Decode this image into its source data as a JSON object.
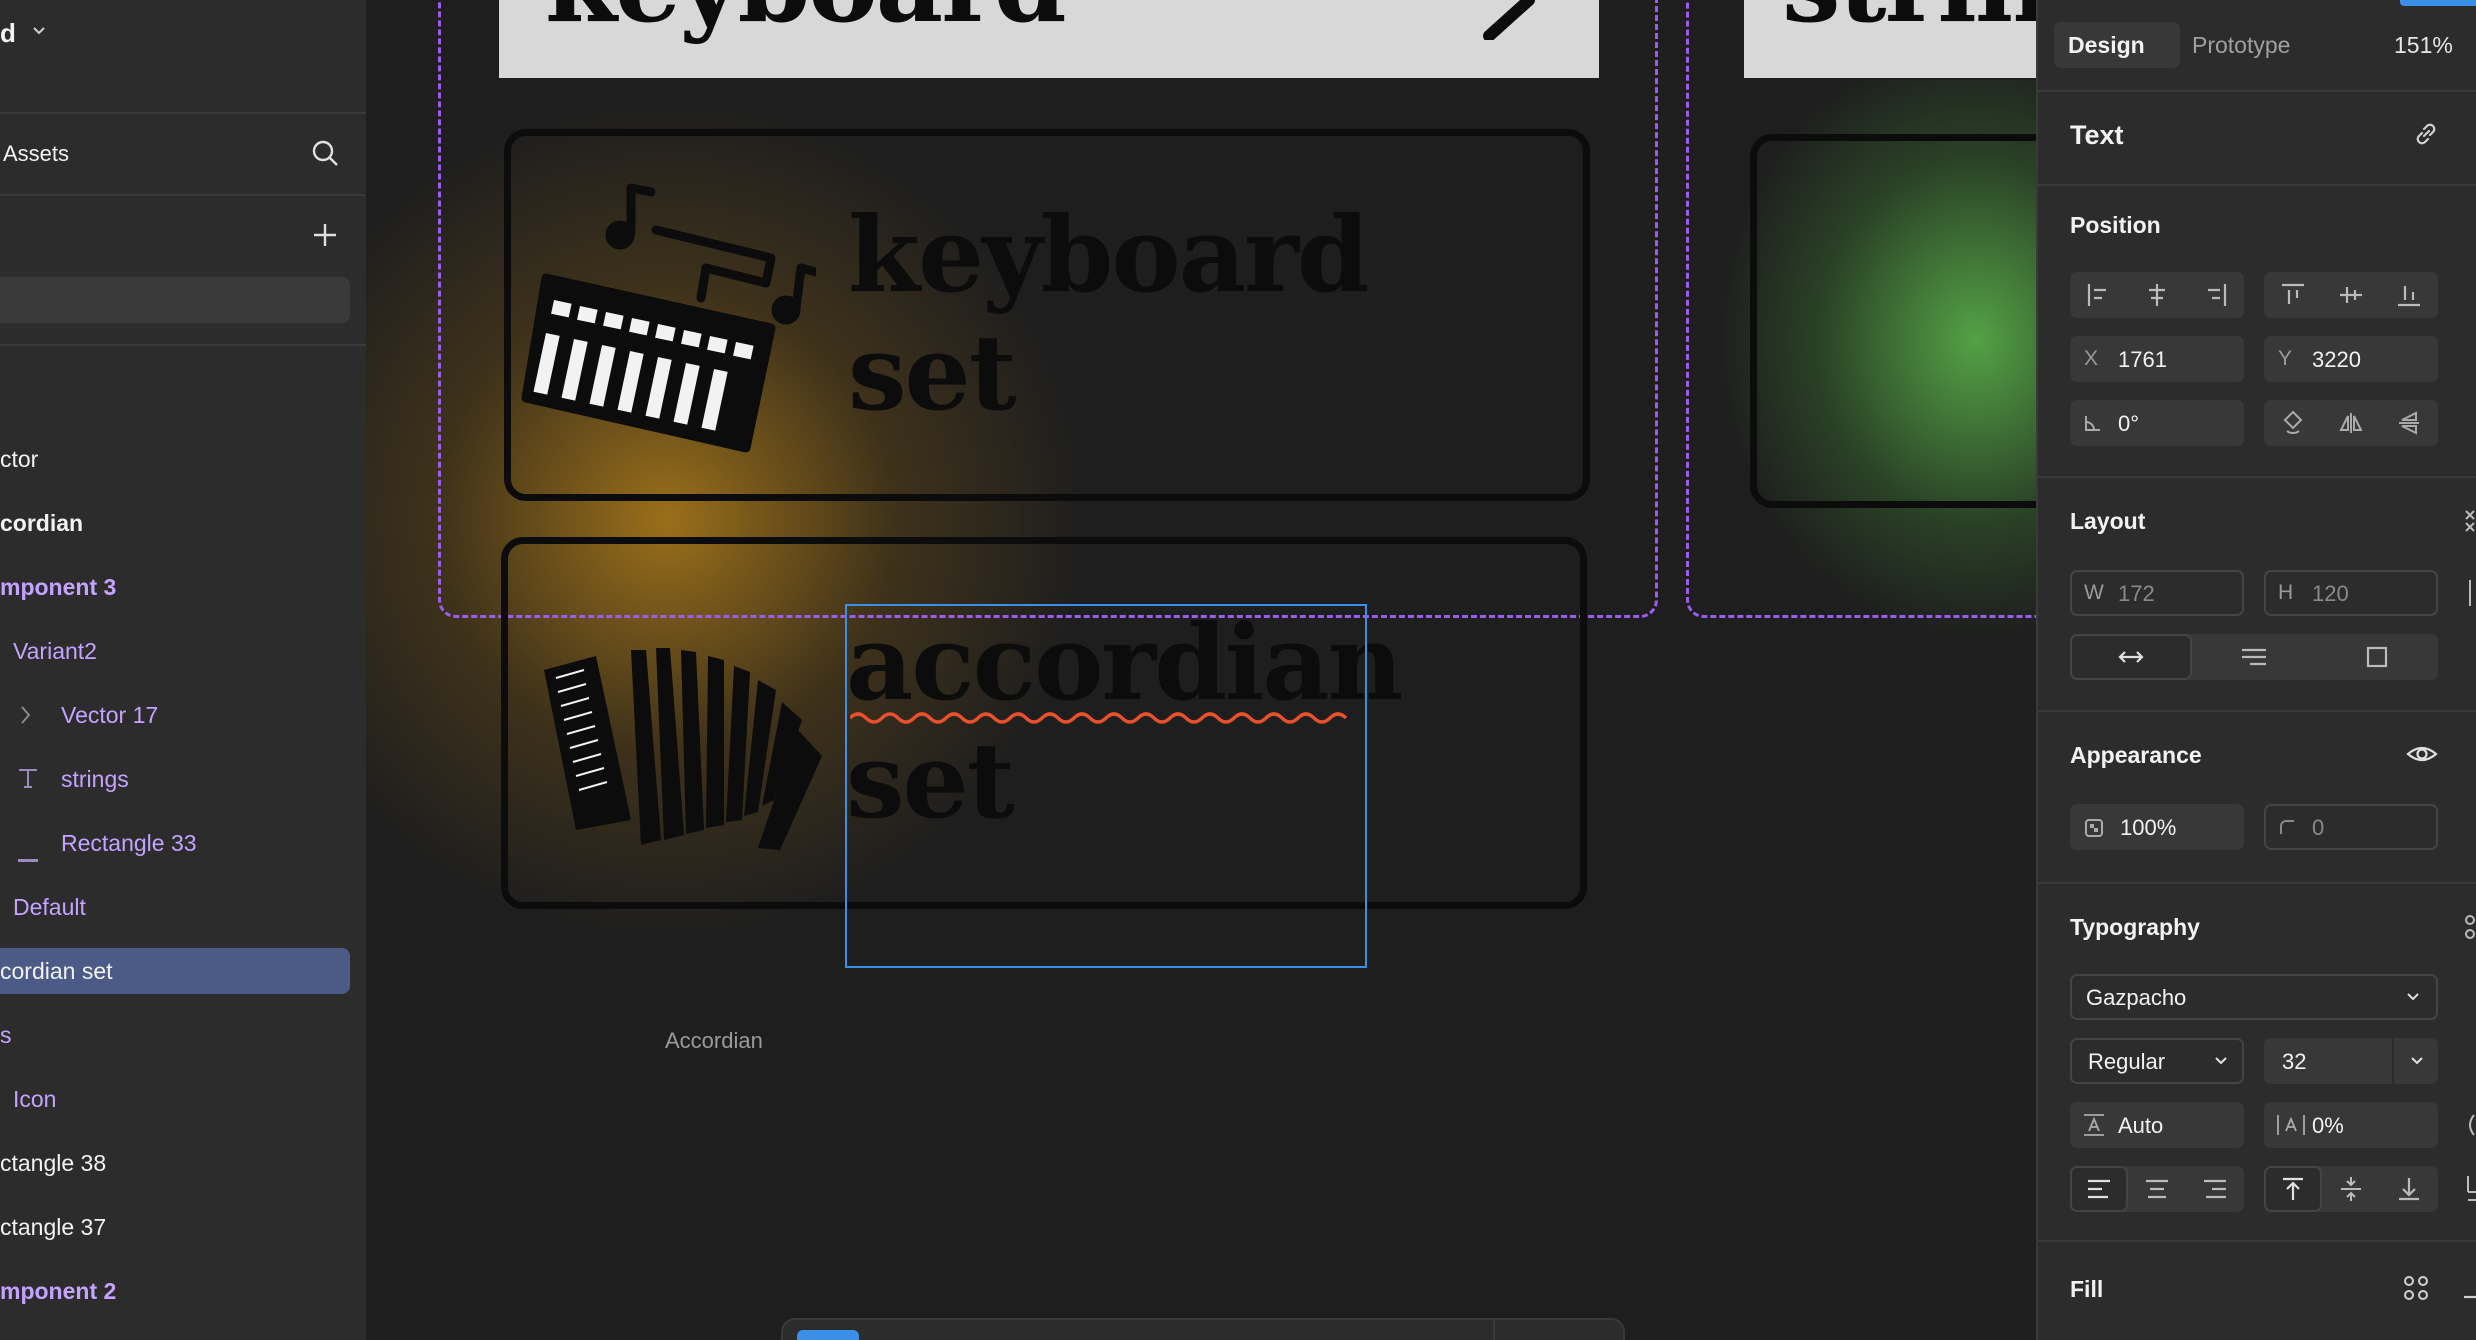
{
  "sidebar": {
    "file_title_partial": "d",
    "assets_label": "Assets",
    "layers": [
      {
        "label": "ctor",
        "style": "white"
      },
      {
        "label": "cordian",
        "style": "white-bold"
      },
      {
        "label": "mponent 3",
        "style": "purple-bold"
      },
      {
        "label": "Variant2",
        "style": "purple"
      },
      {
        "label": "Vector 17",
        "style": "purple",
        "icon": "chevron-right-icon"
      },
      {
        "label": "strings",
        "style": "purple",
        "icon": "text-icon"
      },
      {
        "label": "Rectangle 33",
        "style": "purple",
        "icon": "line-icon"
      },
      {
        "label": "Default",
        "style": "purple"
      },
      {
        "label": "cordian set",
        "style": "white",
        "selected": true
      },
      {
        "label": "s",
        "style": "purple"
      },
      {
        "label": "Icon",
        "style": "purple"
      },
      {
        "label": "ctangle 38",
        "style": "white"
      },
      {
        "label": "ctangle 37",
        "style": "white"
      },
      {
        "label": "mponent 2",
        "style": "purple-bold"
      }
    ]
  },
  "canvas": {
    "top_card_text": "keyboard",
    "top_card_text_right": "string",
    "keyboard_line1": "keyboard",
    "keyboard_line2": "set",
    "accordian_line1": "accordian",
    "accordian_line2": "set",
    "frame_label": "Accordian",
    "colors": {
      "keyboard_glow": "#a8781a",
      "strings_glow": "#5ab04a",
      "dashed": "#9b5cf0",
      "selection": "#3b8fe6",
      "spellcheck": "#e8502e"
    }
  },
  "panel": {
    "tabs": {
      "design": "Design",
      "prototype": "Prototype"
    },
    "zoom": "151%",
    "section_text": "Text",
    "position": {
      "title": "Position",
      "x_label": "X",
      "x": "1761",
      "y_label": "Y",
      "y": "3220",
      "rotation": "0°"
    },
    "layout": {
      "title": "Layout",
      "w_label": "W",
      "w": "172",
      "h_label": "H",
      "h": "120"
    },
    "appearance": {
      "title": "Appearance",
      "opacity": "100%",
      "radius": "0"
    },
    "typography": {
      "title": "Typography",
      "font": "Gazpacho",
      "weight": "Regular",
      "size": "32",
      "line_height": "Auto",
      "letter_spacing": "0%"
    },
    "fill": {
      "title": "Fill"
    }
  }
}
